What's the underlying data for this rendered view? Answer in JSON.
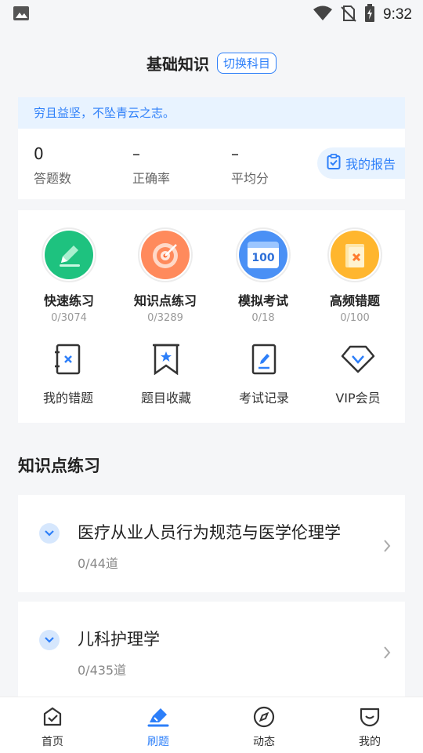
{
  "status_bar": {
    "time": "9:32"
  },
  "header": {
    "title": "基础知识",
    "switch_label": "切换科目"
  },
  "motto": "穷且益坚，不坠青云之志。",
  "stats": [
    {
      "value": "0",
      "label": "答题数"
    },
    {
      "value": "–",
      "label": "正确率"
    },
    {
      "value": "–",
      "label": "平均分"
    }
  ],
  "report_label": "我的报告",
  "features": [
    {
      "label": "快速练习",
      "progress": "0/3074"
    },
    {
      "label": "知识点练习",
      "progress": "0/3289"
    },
    {
      "label": "模拟考试",
      "progress": "0/18",
      "badge": "100"
    },
    {
      "label": "高频错题",
      "progress": "0/100"
    }
  ],
  "tools": [
    {
      "label": "我的错题"
    },
    {
      "label": "题目收藏"
    },
    {
      "label": "考试记录"
    },
    {
      "label": "VIP会员"
    }
  ],
  "section_title": "知识点练习",
  "subjects": [
    {
      "name": "医疗从业人员行为规范与医学伦理学",
      "count": "0/44道"
    },
    {
      "name": "儿科护理学",
      "count": "0/435道"
    }
  ],
  "tabs": [
    {
      "label": "首页"
    },
    {
      "label": "刷题"
    },
    {
      "label": "动态"
    },
    {
      "label": "我的"
    }
  ],
  "colors": {
    "accent": "#2d7ff9",
    "motto_bg": "#e8f3ff",
    "page_bg": "#f5f6f8"
  }
}
